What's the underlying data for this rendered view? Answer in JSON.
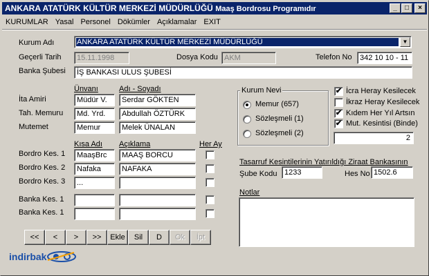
{
  "window": {
    "title": "ANKARA ATATÜRK KÜLTÜR MERKEZİ MÜDÜRLÜĞÜ",
    "subtitle": "Maaş Bordrosu Programıdır",
    "minimize": "_",
    "maximize": "□",
    "close": "×"
  },
  "menu": [
    {
      "label": "KURUMLAR",
      "underline": "K"
    },
    {
      "label": "Yasal",
      "underline": "Y"
    },
    {
      "label": "Personel",
      "underline": "P"
    },
    {
      "label": "Dökümler",
      "underline": "D"
    },
    {
      "label": "Açıklamalar",
      "underline": "A"
    },
    {
      "label": "EXIT",
      "underline": "X"
    }
  ],
  "form": {
    "kurum_adi_label": "Kurum Adı",
    "kurum_adi_value": "ANKARA ATATÜRK KÜLTÜR MERKEZİ MÜDÜRLÜĞÜ",
    "gecerli_tarih_label": "Geçerli Tarih",
    "gecerli_tarih_value": "15.11.1998",
    "dosya_kodu_label": "Dosya Kodu",
    "dosya_kodu_value": "AKM",
    "telefon_label": "Telefon No",
    "telefon_value": "342 10 10 - 11",
    "banka_subesi_label": "Banka Şubesi",
    "banka_subesi_value": "İŞ BANKASI ULUS ŞUBESİ",
    "unvani_header": "Ünvanı",
    "adi_soyadi_header": "Adı - Soyadı",
    "officials": [
      {
        "label": "İta Amiri",
        "unvan": "Müdür V.",
        "ad": "Serdar GÖKTEN"
      },
      {
        "label": "Tah. Memuru",
        "unvan": "Md. Yrd.",
        "ad": "Abdullah ÖZTÜRK"
      },
      {
        "label": "Mutemet",
        "unvan": "Memur",
        "ad": "Melek ÜNALAN"
      }
    ],
    "kisa_adi_header": "Kısa Adı",
    "aciklama_header": "Açıklama",
    "her_ay_header": "Her Ay",
    "deductions": [
      {
        "label": "Bordro Kes. 1",
        "kisa": "MaaşBrc",
        "aciklama": "MAAŞ BORCU",
        "her_ay": false
      },
      {
        "label": "Bordro Kes. 2",
        "kisa": "Nafaka",
        "aciklama": "NAFAKA",
        "her_ay": false
      },
      {
        "label": "Bordro Kes. 3",
        "kisa": "...",
        "aciklama": "",
        "her_ay": false
      },
      {
        "label": "Banka Kes. 1",
        "kisa": "",
        "aciklama": "",
        "her_ay": false
      },
      {
        "label": "Banka Kes. 1",
        "kisa": "",
        "aciklama": "",
        "her_ay": false
      }
    ],
    "kurum_nevi": {
      "title": "Kurum Nevi",
      "options": [
        {
          "label": "Memur (657)",
          "selected": true
        },
        {
          "label": "Sözleşmeli (1)",
          "selected": false
        },
        {
          "label": "Sözleşmeli (2)",
          "selected": false
        }
      ]
    },
    "checks": [
      {
        "label": "İcra Heray Kesilecek",
        "checked": true
      },
      {
        "label": "İkraz Heray Kesilecek",
        "checked": false
      },
      {
        "label": "Kıdem Her Yıl Artsın",
        "checked": true
      },
      {
        "label": "Mut. Kesintisi (Binde)",
        "checked": true
      }
    ],
    "binde_value": "2",
    "ziraat_title": "Tasarruf Kesintilerinin Yatırıldığı Ziraat Bankasının",
    "sube_kodu_label": "Şube Kodu",
    "sube_kodu_value": "1233",
    "hes_no_label": "Hes No",
    "hes_no_value": "1502.6",
    "notlar_label": "Notlar",
    "check_mark": "✔"
  },
  "buttons": {
    "first": "<<",
    "prev": "<",
    "next": ">",
    "last": ">>",
    "ekle": "Ekle",
    "sil": "Sil",
    "d": "D",
    "ok": "Ok",
    "ipt": "İpt"
  },
  "logo": {
    "text": "indirbak"
  },
  "colors": {
    "titlebar": "#0a246a",
    "face": "#d4d0c8",
    "logo": "#1a4fa8"
  }
}
